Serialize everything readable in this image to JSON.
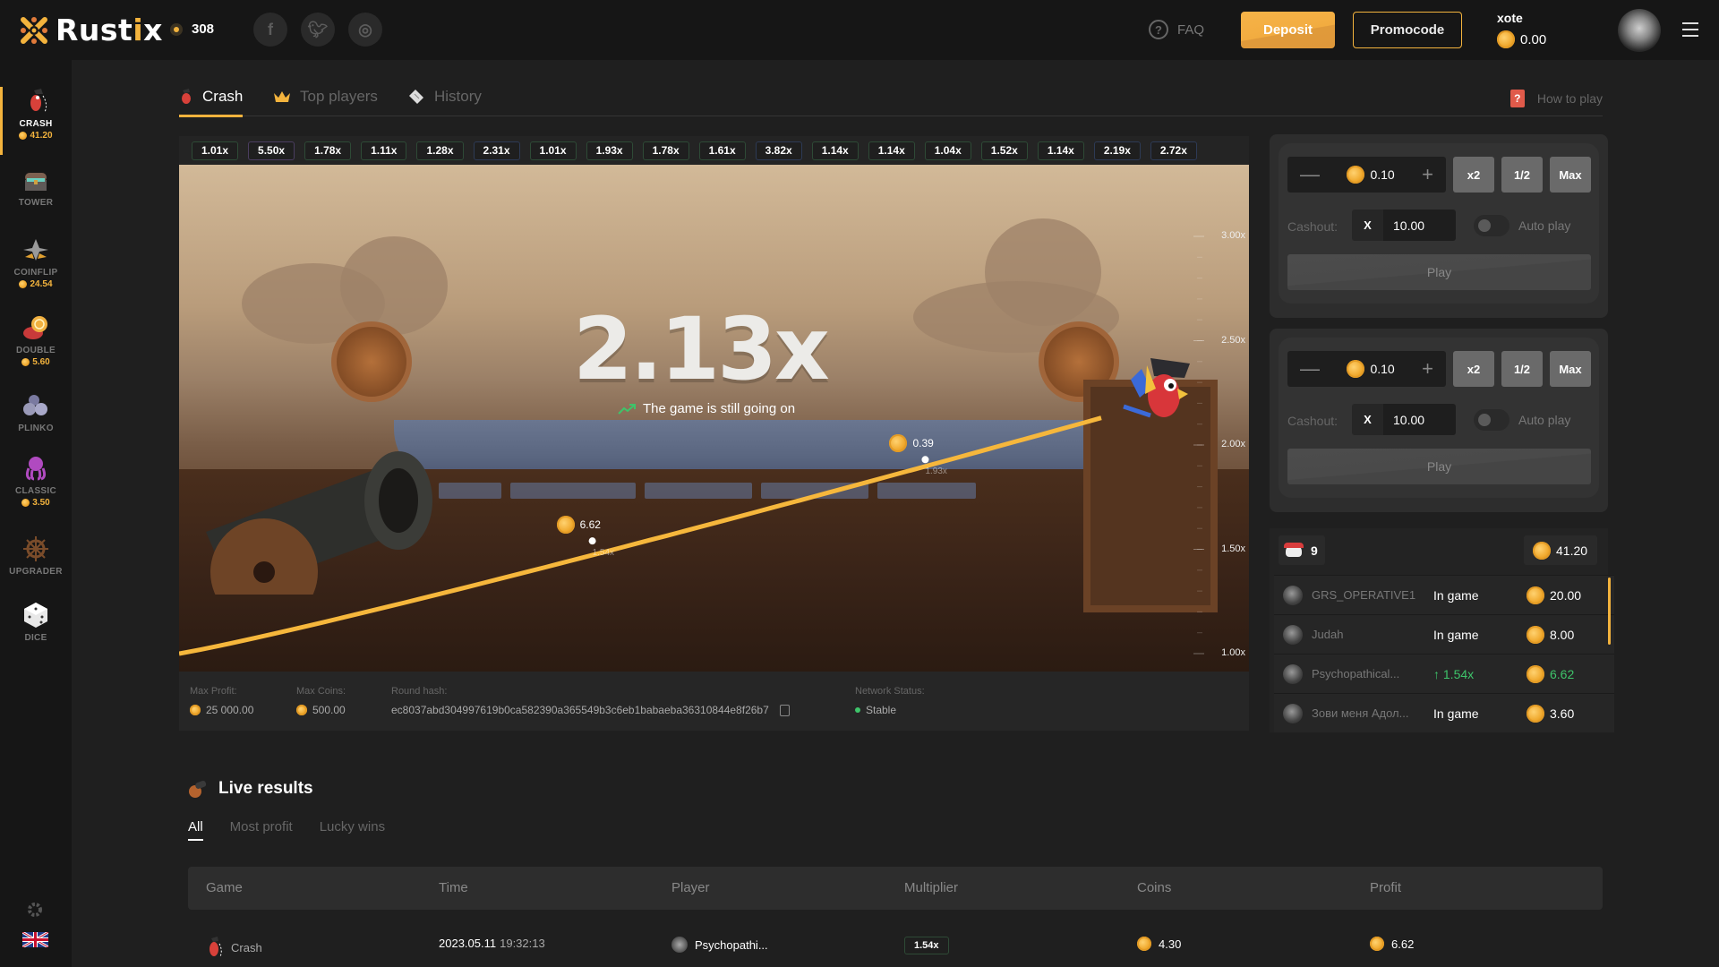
{
  "header": {
    "brand": {
      "prefix": "Rust",
      "highlight": "i",
      "suffix": "x"
    },
    "online_count": "308",
    "social": [
      {
        "name": "facebook",
        "glyph": "f"
      },
      {
        "name": "twitter",
        "glyph": "t"
      },
      {
        "name": "instagram",
        "glyph": "◎"
      }
    ],
    "faq_label": "FAQ",
    "faq_glyph": "?",
    "deposit_label": "Deposit",
    "promocode_label": "Promocode",
    "username": "xote",
    "balance": "0.00"
  },
  "sidebar": {
    "items": [
      {
        "id": "crash",
        "label": "CRASH",
        "value": "41.20",
        "active": true,
        "icon": "parrot-icon"
      },
      {
        "id": "tower",
        "label": "TOWER",
        "value": null,
        "icon": "treasure-chest-icon"
      },
      {
        "id": "coinflip",
        "label": "COINFLIP",
        "value": "24.54",
        "icon": "crossed-swords-icon"
      },
      {
        "id": "double",
        "label": "DOUBLE",
        "value": "5.60",
        "icon": "chips-icon"
      },
      {
        "id": "plinko",
        "label": "PLINKO",
        "value": null,
        "icon": "balls-icon"
      },
      {
        "id": "classic",
        "label": "CLASSIC",
        "value": "3.50",
        "icon": "octopus-icon"
      },
      {
        "id": "upgrader",
        "label": "UPGRADER",
        "value": null,
        "icon": "ship-wheel-icon"
      },
      {
        "id": "dice",
        "label": "DICE",
        "value": null,
        "icon": "dice-icon"
      }
    ],
    "settings_icon": "gear-icon",
    "language": "EN"
  },
  "tabs": {
    "items": [
      {
        "label": "Crash",
        "active": true
      },
      {
        "label": "Top players",
        "active": false
      },
      {
        "label": "History",
        "active": false
      }
    ],
    "how_to_play": "How to play"
  },
  "history": [
    {
      "value": "1.01x",
      "tone": "green"
    },
    {
      "value": "5.50x",
      "tone": "purple"
    },
    {
      "value": "1.78x",
      "tone": "green"
    },
    {
      "value": "1.11x",
      "tone": "green"
    },
    {
      "value": "1.28x",
      "tone": "green"
    },
    {
      "value": "2.31x",
      "tone": "blue"
    },
    {
      "value": "1.01x",
      "tone": "green"
    },
    {
      "value": "1.93x",
      "tone": "green"
    },
    {
      "value": "1.78x",
      "tone": "green"
    },
    {
      "value": "1.61x",
      "tone": "green"
    },
    {
      "value": "3.82x",
      "tone": "blue"
    },
    {
      "value": "1.14x",
      "tone": "green"
    },
    {
      "value": "1.14x",
      "tone": "green"
    },
    {
      "value": "1.04x",
      "tone": "green"
    },
    {
      "value": "1.52x",
      "tone": "green"
    },
    {
      "value": "1.14x",
      "tone": "green"
    },
    {
      "value": "2.19x",
      "tone": "blue"
    },
    {
      "value": "2.72x",
      "tone": "blue"
    }
  ],
  "game": {
    "current_multiplier": "2.13x",
    "status_text": "The game is still going on",
    "axis_labels": [
      "3.00x",
      "2.50x",
      "2.00x",
      "1.50x",
      "1.00x"
    ],
    "cashouts": [
      {
        "amount": "6.62",
        "multiplier": "1.54x"
      },
      {
        "amount": "0.39",
        "multiplier": "1.93x"
      }
    ]
  },
  "info": {
    "max_profit_label": "Max Profit:",
    "max_profit": "25 000.00",
    "max_coins_label": "Max Coins:",
    "max_coins": "500.00",
    "round_hash_label": "Round hash:",
    "round_hash": "ec8037abd304997619b0ca582390a365549b3c6eb1babaeba36310844e8f26b7",
    "network_label": "Network Status:",
    "network_status": "Stable"
  },
  "bet_panels": [
    {
      "amount": "0.10",
      "double": "x2",
      "half": "1/2",
      "max": "Max",
      "cashout_label": "Cashout:",
      "cashout_prefix": "X",
      "cashout_value": "10.00",
      "auto_play": "Auto play",
      "auto_on": false,
      "play_label": "Play"
    },
    {
      "amount": "0.10",
      "double": "x2",
      "half": "1/2",
      "max": "Max",
      "cashout_label": "Cashout:",
      "cashout_prefix": "X",
      "cashout_value": "10.00",
      "auto_play": "Auto play",
      "auto_on": false,
      "play_label": "Play"
    }
  ],
  "players": {
    "count": "9",
    "total": "41.20",
    "rows": [
      {
        "name": "GRS_OPERATIVE1",
        "status": "In game",
        "amount": "20.00",
        "win": false
      },
      {
        "name": "Judah",
        "status": "In game",
        "amount": "8.00",
        "win": false
      },
      {
        "name": "Psychopathical...",
        "status": "↑ 1.54x",
        "amount": "6.62",
        "win": true
      },
      {
        "name": "Зови меня Адол...",
        "status": "In game",
        "amount": "3.60",
        "win": false
      }
    ]
  },
  "live_results": {
    "title": "Live results",
    "tabs": [
      "All",
      "Most profit",
      "Lucky wins"
    ],
    "columns": [
      "Game",
      "Time",
      "Player",
      "Multiplier",
      "Coins",
      "Profit"
    ],
    "rows": [
      {
        "game": "Crash",
        "date": "2023.05.11",
        "time": "19:32:13",
        "player": "Psychopathi...",
        "multiplier": "1.54x",
        "coins": "4.30",
        "profit": "6.62"
      }
    ]
  }
}
